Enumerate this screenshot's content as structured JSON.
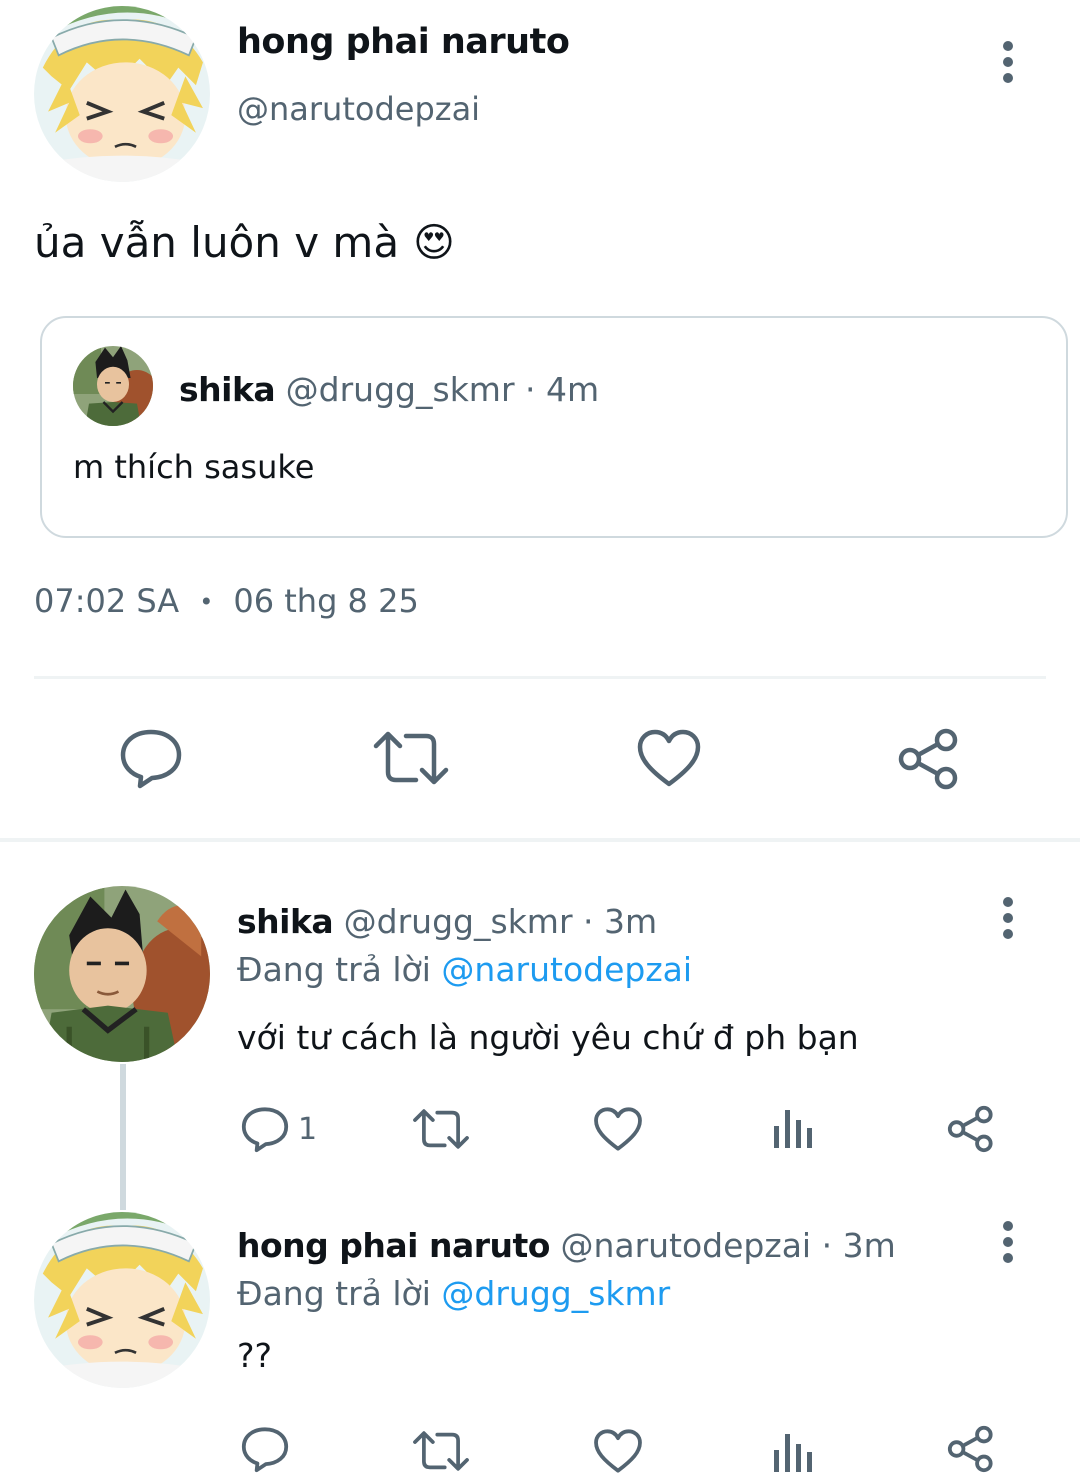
{
  "main_tweet": {
    "author_name": "hong phai naruto",
    "author_handle": "@narutodepzai",
    "text": "ủa vẫn luôn v mà",
    "emoji": "😍",
    "quoted": {
      "name": "shika",
      "handle": "@drugg_skmr",
      "time": "· 4m",
      "text": "m thích sasuke"
    },
    "time": "07:02 SA",
    "separator": "•",
    "date": "06 thg 8 25",
    "actions": [
      "reply-icon",
      "retweet-icon",
      "like-icon",
      "share-icon"
    ]
  },
  "replies": [
    {
      "name": "shika",
      "handle": "@drugg_skmr",
      "time": "· 3m",
      "replying_label": "Đang trả lời",
      "replying_to": "@narutodepzai",
      "text": "với tư cách là người yêu chứ đ ph bạn",
      "reply_count": "1"
    },
    {
      "name": "hong phai naruto",
      "handle": "@narutodepzai",
      "time": "· 3m",
      "replying_label": "Đang trả lời",
      "replying_to": "@drugg_skmr",
      "text": "??"
    }
  ],
  "colors": {
    "text": "#0f1419",
    "secondary": "#536471",
    "link": "#1d9bf0",
    "divider": "#eff3f4"
  }
}
